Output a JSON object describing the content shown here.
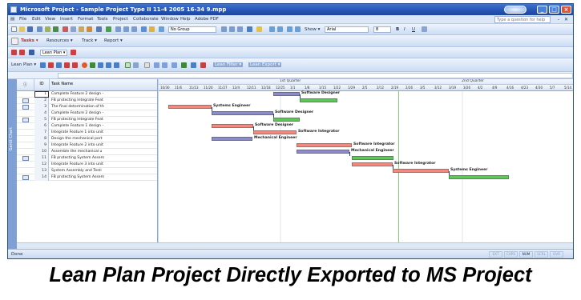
{
  "window": {
    "title": "Microsoft Project - Sample Project Type II 11-4 2005 16-34 9.mpp",
    "controls": [
      "_",
      "□",
      "×"
    ]
  },
  "menu": {
    "items": [
      "File",
      "Edit",
      "View",
      "Insert",
      "Format",
      "Tools",
      "Project",
      "Collaborate",
      "Window",
      "Help",
      "Adobe PDF"
    ],
    "help_placeholder": "Type a question for help",
    "mdi_controls": "- ✕"
  },
  "toolbar": {
    "group_value": "No Group",
    "show_label": "Show ▾",
    "font_value": "Arial",
    "font_size": "8",
    "bold": "B",
    "italic": "I",
    "underline": "U",
    "tasks_label": "Tasks ▾",
    "resources_label": "Resources ▾",
    "track_label": "Track ▾",
    "report_label": "Report ▾",
    "pdf_label": "Lean Plan ▾",
    "fx_label": "Lean Plan ▾",
    "hide_label": "Filter ▾",
    "filter1": "Lean Filter ▾",
    "filter2": "Lean Export ▾"
  },
  "grid": {
    "header_id": "ID",
    "header_name": "Task Name",
    "header_info": "ⓘ",
    "rows": [
      {
        "id": "1",
        "name": "Complete Feature 2 design -",
        "flag": false
      },
      {
        "id": "2",
        "name": "FB protecting Integrate Feat",
        "flag": true
      },
      {
        "id": "3",
        "name": "The final determination of th",
        "flag": true
      },
      {
        "id": "4",
        "name": "Complete Feature 2 design -",
        "flag": false
      },
      {
        "id": "5",
        "name": "FB protecting Integrate Feat",
        "flag": true
      },
      {
        "id": "6",
        "name": "Complete Feature 1 design -",
        "flag": false
      },
      {
        "id": "7",
        "name": "Integrate Feature 1 into unit",
        "flag": false
      },
      {
        "id": "8",
        "name": "Design the mechanical port",
        "flag": false
      },
      {
        "id": "9",
        "name": "Integrate Feature 2 into unit",
        "flag": false
      },
      {
        "id": "10",
        "name": "Assemble the mechanical u",
        "flag": false
      },
      {
        "id": "11",
        "name": "FB protecting System Assem",
        "flag": true
      },
      {
        "id": "12",
        "name": "Integrate Feature 3 into unit",
        "flag": false
      },
      {
        "id": "13",
        "name": "System Assembly and Testi",
        "flag": false
      },
      {
        "id": "14",
        "name": "FB protecting System Assem",
        "flag": true
      }
    ]
  },
  "chart": {
    "quarters": [
      "1st Quarter",
      "2nd Quarter"
    ],
    "dates": [
      "10/30",
      "11/6",
      "11/13",
      "11/20",
      "11/27",
      "12/4",
      "12/11",
      "12/18",
      "12/25",
      "1/1",
      "1/8",
      "1/15",
      "1/22",
      "1/29",
      "2/5",
      "2/12",
      "2/19",
      "2/26",
      "3/5",
      "3/12",
      "3/19",
      "3/26",
      "4/2",
      "4/9",
      "4/16",
      "4/23",
      "4/30",
      "5/7",
      "5/14"
    ],
    "colors": {
      "purple": "#8e8cc7",
      "red": "#ee8a80",
      "green": "#63c35d",
      "link": "#31417a"
    },
    "bars": [
      {
        "row": 1,
        "start": 143,
        "end": 176,
        "color": "purple",
        "label": "Software Designer"
      },
      {
        "row": 2,
        "start": 176,
        "end": 223,
        "color": "green",
        "label": ""
      },
      {
        "row": 3,
        "start": 12,
        "end": 66,
        "color": "red",
        "label": "Systems Engineer"
      },
      {
        "row": 4,
        "start": 66,
        "end": 143,
        "color": "purple",
        "label": "Software Designer"
      },
      {
        "row": 5,
        "start": 143,
        "end": 176,
        "color": "green",
        "label": ""
      },
      {
        "row": 6,
        "start": 66,
        "end": 118,
        "color": "red",
        "label": "Software Designer"
      },
      {
        "row": 7,
        "start": 118,
        "end": 172,
        "color": "red",
        "label": "Software Integrator"
      },
      {
        "row": 8,
        "start": 66,
        "end": 117,
        "color": "purple",
        "label": "Mechanical Engineer"
      },
      {
        "row": 9,
        "start": 172,
        "end": 241,
        "color": "red",
        "label": "Software Integrator"
      },
      {
        "row": 10,
        "start": 172,
        "end": 238,
        "color": "purple",
        "label": "Mechanical Engineer"
      },
      {
        "row": 11,
        "start": 241,
        "end": 293,
        "color": "green",
        "label": ""
      },
      {
        "row": 12,
        "start": 241,
        "end": 292,
        "color": "red",
        "label": "Software Integrator"
      },
      {
        "row": 13,
        "start": 292,
        "end": 362,
        "color": "red",
        "label": "Systems Engineer"
      },
      {
        "row": 14,
        "start": 362,
        "end": 437,
        "color": "green",
        "label": ""
      }
    ]
  },
  "status": {
    "text": "Done",
    "indicators": [
      "EXT",
      "CAPS",
      "NUM",
      "SCRL",
      "OVR"
    ]
  },
  "caption": "Lean Plan Project Directly Exported to MS Project"
}
